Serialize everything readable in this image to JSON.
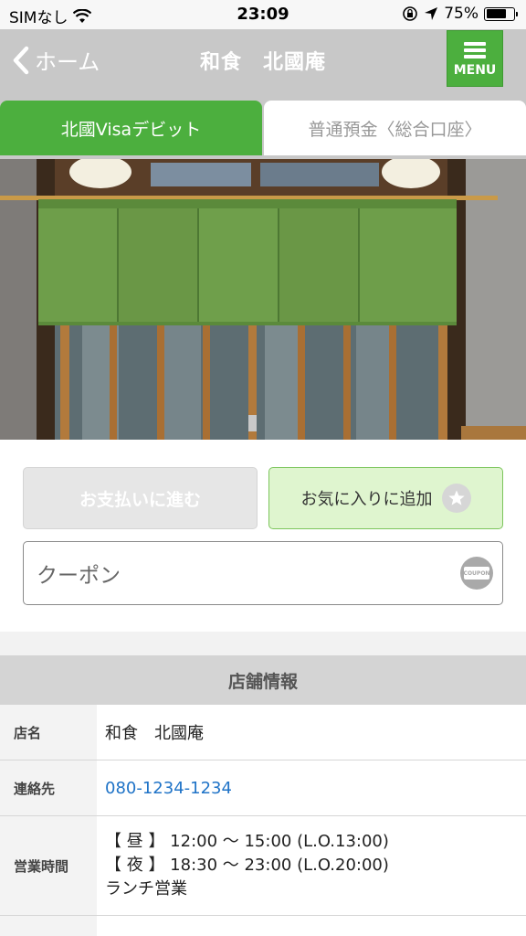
{
  "status_bar": {
    "carrier": "SIMなし",
    "time": "23:09",
    "battery": "75%",
    "battery_level": 0.75
  },
  "nav": {
    "back_label": "ホーム",
    "title": "和食　北國庵",
    "menu_label": "MENU"
  },
  "tabs": [
    {
      "label": "北國Visaデビット",
      "active": true
    },
    {
      "label": "普通預金〈総合口座〉",
      "active": false
    }
  ],
  "actions": {
    "pay_label": "お支払いに進む",
    "favorite_label": "お気に入りに追加",
    "coupon_placeholder": "クーポン",
    "coupon_icon_text": "COUPON"
  },
  "shop_info": {
    "header": "店舗情報",
    "rows": [
      {
        "label": "店名",
        "value": "和食　北國庵"
      },
      {
        "label": "連絡先",
        "value": "080-1234-1234"
      },
      {
        "label": "営業時間",
        "lines": [
          "【 昼 】 12:00 〜 15:00 (L.O.13:00)",
          "【 夜 】 18:30 〜 23:00 (L.O.20:00)",
          "ランチ営業"
        ]
      }
    ]
  },
  "colors": {
    "accent_green": "#4caf3e",
    "nav_gray": "#c8c8c8",
    "link_blue": "#1f73c7"
  }
}
